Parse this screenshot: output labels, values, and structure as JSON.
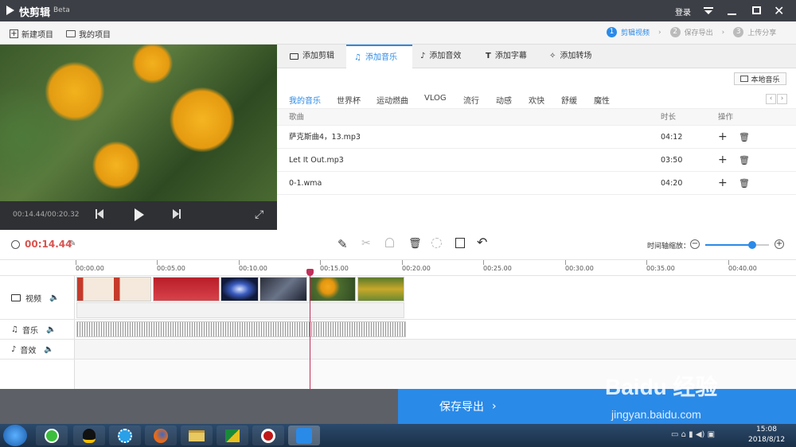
{
  "app": {
    "title": "快剪辑",
    "badge": "Beta",
    "login": "登录"
  },
  "toolbar": {
    "new_project": "新建项目",
    "my_projects": "我的项目",
    "steps": [
      {
        "num": "1",
        "label": "剪辑视频"
      },
      {
        "num": "2",
        "label": "保存导出"
      },
      {
        "num": "3",
        "label": "上传分享"
      }
    ]
  },
  "preview": {
    "time": "00:14.44/00:20.32"
  },
  "tabs": [
    {
      "label": "添加剪辑",
      "icon": "video-icon"
    },
    {
      "label": "添加音乐",
      "icon": "music-icon"
    },
    {
      "label": "添加音效",
      "icon": "sound-effect-icon"
    },
    {
      "label": "添加字幕",
      "icon": "text-icon"
    },
    {
      "label": "添加转场",
      "icon": "transition-icon"
    }
  ],
  "local_music": "本地音乐",
  "categories": [
    "我的音乐",
    "世界杯",
    "运动燃曲",
    "VLOG",
    "流行",
    "动感",
    "欢快",
    "舒缓",
    "魔性"
  ],
  "table": {
    "headers": {
      "song": "歌曲",
      "duration": "时长",
      "actions": "操作"
    },
    "rows": [
      {
        "name": "萨克斯曲4，13.mp3",
        "duration": "04:12"
      },
      {
        "name": "Let It Out.mp3",
        "duration": "03:50"
      },
      {
        "name": "0-1.wma",
        "duration": "04:20"
      }
    ]
  },
  "editbar": {
    "current_time": "00:14.44",
    "zoom_label": "时间轴缩放："
  },
  "ruler": [
    "00:00.00",
    "00:05.00",
    "00:10.00",
    "00:15.00",
    "00:20.00",
    "00:25.00",
    "00:30.00",
    "00:35.00",
    "00:40.00"
  ],
  "tracks": {
    "video": "视频",
    "music": "音乐",
    "sfx": "音效"
  },
  "save_export": "保存导出",
  "taskbar": {
    "time": "15:08",
    "date": "2018/8/12"
  },
  "watermark": {
    "line1": "Baidu 经验",
    "line2": "jingyan.baidu.com"
  },
  "colors": {
    "accent": "#2a8ae8",
    "playhead": "#c0305a",
    "titlebar": "#3c3f46"
  }
}
